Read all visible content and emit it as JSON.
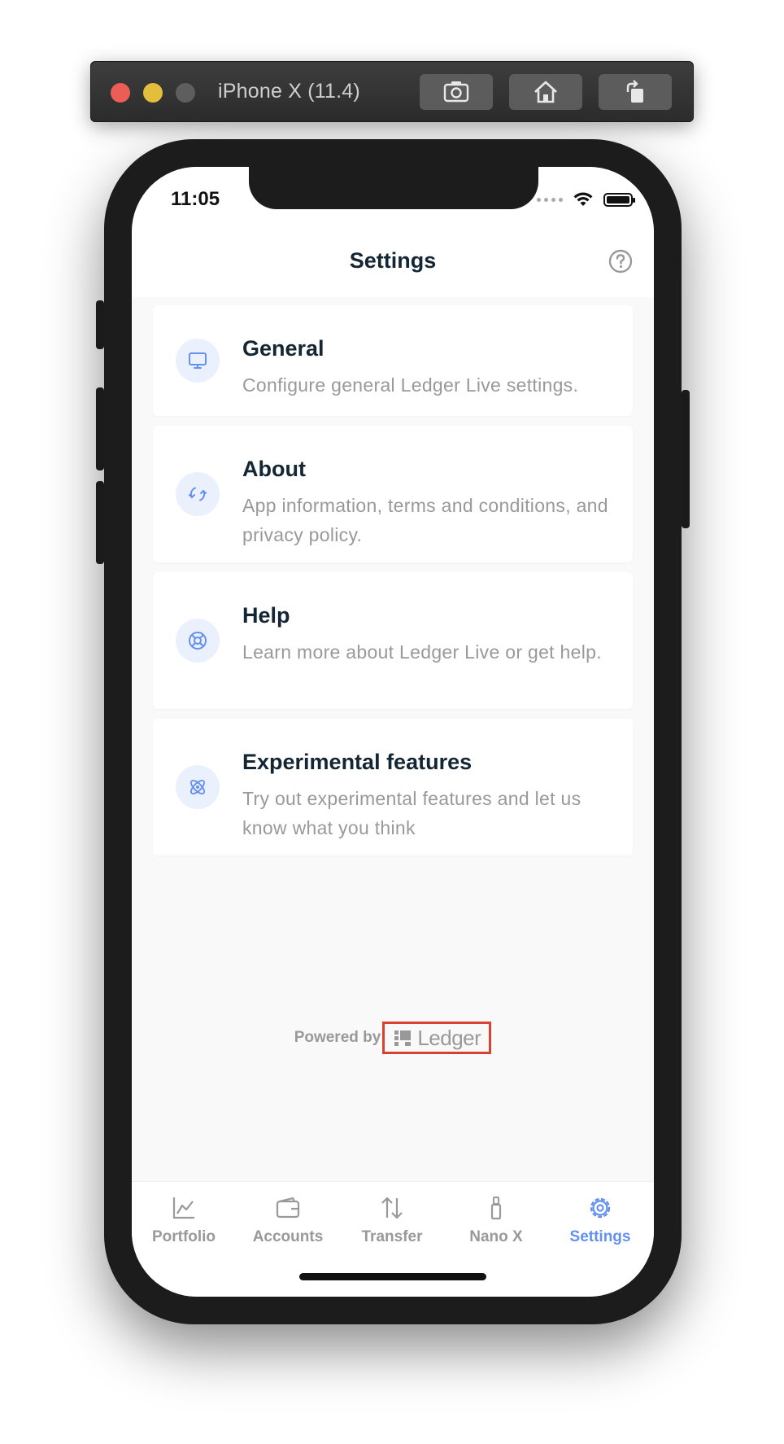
{
  "simulator": {
    "title": "iPhone X (11.4)",
    "buttons": [
      "screenshot-icon",
      "home-icon",
      "rotate-icon"
    ]
  },
  "status_bar": {
    "time": "11:05"
  },
  "header": {
    "title": "Settings",
    "help_icon": "help-circle-icon"
  },
  "cards": [
    {
      "icon": "monitor-icon",
      "title": "General",
      "description": "Configure general Ledger Live settings."
    },
    {
      "icon": "refresh-icon",
      "title": "About",
      "description": "App information, terms and conditions, and privacy policy."
    },
    {
      "icon": "lifebuoy-icon",
      "title": "Help",
      "description": "Learn more about Ledger Live or get help."
    },
    {
      "icon": "atom-icon",
      "title": "Experimental features",
      "description": "Try out experimental features and let us know what you think"
    }
  ],
  "footer": {
    "powered_by": "Powered by",
    "brand": "Ledger"
  },
  "tabs": [
    {
      "label": "Portfolio",
      "icon": "chart-icon",
      "active": false
    },
    {
      "label": "Accounts",
      "icon": "wallet-icon",
      "active": false
    },
    {
      "label": "Transfer",
      "icon": "transfer-arrows-icon",
      "active": false
    },
    {
      "label": "Nano X",
      "icon": "nano-device-icon",
      "active": false
    },
    {
      "label": "Settings",
      "icon": "gear-icon",
      "active": true
    }
  ],
  "colors": {
    "accent": "#6490f1",
    "title": "#142533",
    "muted": "#999999",
    "highlight_box": "#d8412f"
  }
}
